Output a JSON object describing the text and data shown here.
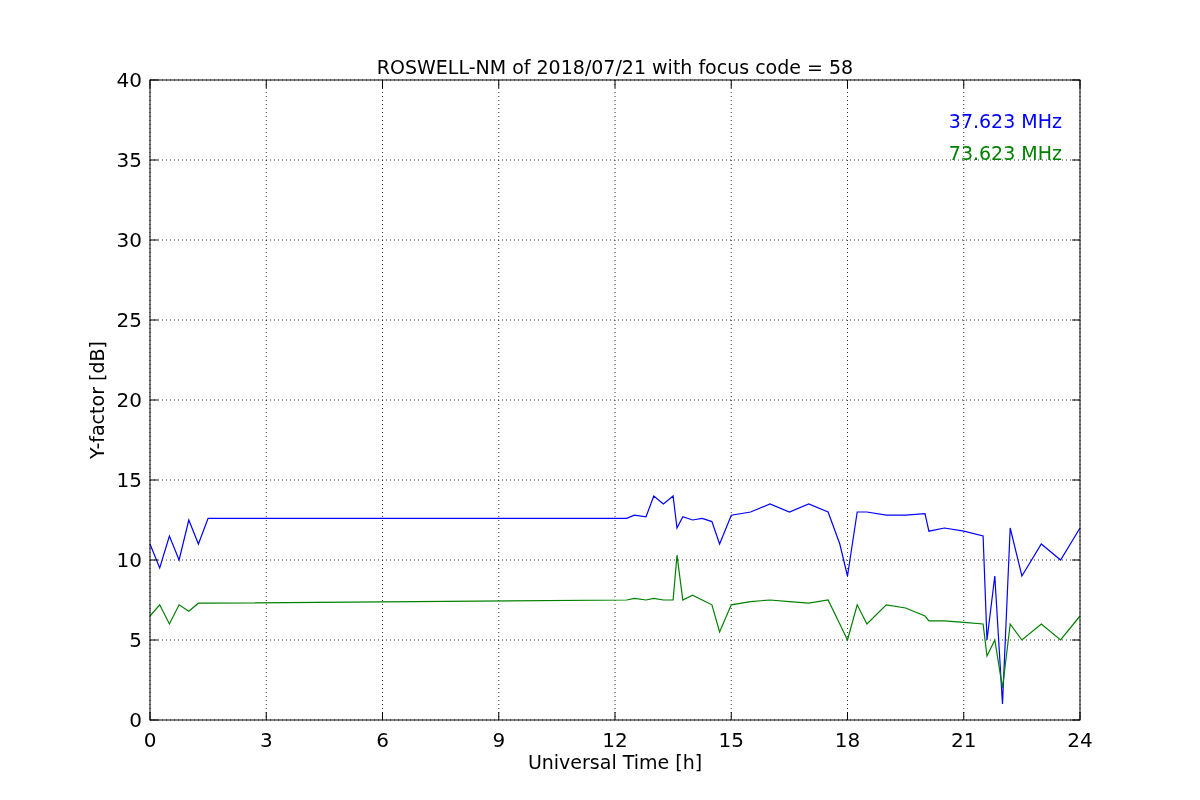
{
  "chart_data": {
    "type": "line",
    "title": "ROSWELL-NM of 2018/07/21 with focus code = 58",
    "xlabel": "Universal Time [h]",
    "ylabel": "Y-factor [dB]",
    "x": [
      0,
      0.25,
      0.5,
      0.75,
      1,
      1.25,
      1.5,
      12.3,
      12.5,
      12.8,
      13,
      13.25,
      13.5,
      13.6,
      13.75,
      14,
      14.25,
      14.5,
      14.7,
      15,
      15.5,
      16,
      16.5,
      17,
      17.5,
      17.8,
      18,
      18.25,
      18.5,
      19,
      19.5,
      20,
      20.1,
      20.5,
      21,
      21.5,
      21.6,
      21.8,
      22,
      22.2,
      22.5,
      23,
      23.5,
      24
    ],
    "series": [
      {
        "name": "37.623 MHz",
        "color": "#0000ff",
        "values": [
          11,
          9.5,
          11.5,
          10,
          12.5,
          11,
          12.6,
          12.6,
          12.8,
          12.7,
          14,
          13.5,
          14,
          12,
          12.7,
          12.5,
          12.6,
          12.4,
          11,
          12.8,
          13,
          13.5,
          13,
          13.5,
          13,
          11,
          9,
          13,
          13,
          12.8,
          12.8,
          12.9,
          11.8,
          12,
          11.8,
          11.5,
          5,
          9,
          1,
          12,
          9,
          11,
          10,
          12
        ]
      },
      {
        "name": "73.623 MHz",
        "color": "#008000",
        "values": [
          6.5,
          7.2,
          6,
          7.2,
          6.8,
          7.3,
          7.3,
          7.5,
          7.6,
          7.5,
          7.6,
          7.5,
          7.5,
          10.3,
          7.5,
          7.8,
          7.5,
          7.2,
          5.5,
          7.2,
          7.4,
          7.5,
          7.4,
          7.3,
          7.5,
          6,
          5,
          7.2,
          6,
          7.2,
          7,
          6.5,
          6.2,
          6.2,
          6.1,
          6,
          4,
          5,
          2,
          6,
          5,
          6,
          5,
          6.5
        ]
      }
    ],
    "xlim": [
      0,
      24
    ],
    "ylim": [
      0,
      40
    ],
    "xticks": [
      0,
      3,
      6,
      9,
      12,
      15,
      18,
      21,
      24
    ],
    "yticks": [
      0,
      5,
      10,
      15,
      20,
      25,
      30,
      35,
      40
    ],
    "grid": true
  }
}
